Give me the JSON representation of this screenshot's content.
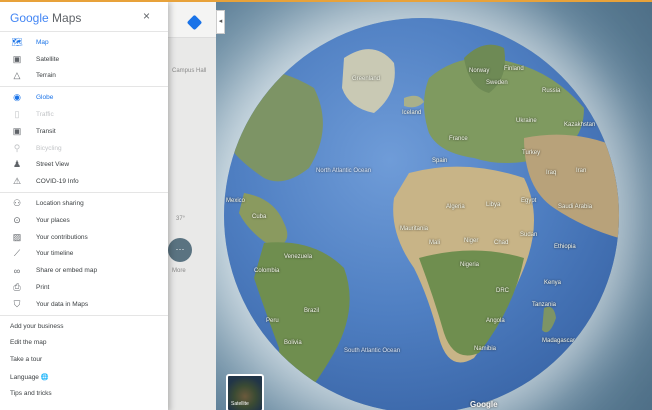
{
  "header": {
    "logo_google": "Google",
    "logo_maps": "Maps",
    "close": "×"
  },
  "menu": {
    "view_group": [
      {
        "icon": "map-icon",
        "glyph": "🗺",
        "label": "Map",
        "state": "active"
      },
      {
        "icon": "satellite-icon",
        "glyph": "▣",
        "label": "Satellite",
        "state": "normal"
      },
      {
        "icon": "terrain-icon",
        "glyph": "△",
        "label": "Terrain",
        "state": "normal"
      }
    ],
    "layers_group": [
      {
        "icon": "globe-icon",
        "glyph": "◉",
        "label": "Globe",
        "state": "active"
      },
      {
        "icon": "traffic-icon",
        "glyph": "▯",
        "label": "Traffic",
        "state": "disabled"
      },
      {
        "icon": "transit-icon",
        "glyph": "▣",
        "label": "Transit",
        "state": "normal"
      },
      {
        "icon": "bicycling-icon",
        "glyph": "⚲",
        "label": "Bicycling",
        "state": "disabled"
      },
      {
        "icon": "street-view-icon",
        "glyph": "♟",
        "label": "Street View",
        "state": "normal"
      },
      {
        "icon": "covid-info-icon",
        "glyph": "⚠",
        "label": "COVID-19 Info",
        "state": "normal"
      }
    ],
    "tools_group": [
      {
        "icon": "location-sharing-icon",
        "glyph": "⚇",
        "label": "Location sharing"
      },
      {
        "icon": "your-places-icon",
        "glyph": "⊙",
        "label": "Your places"
      },
      {
        "icon": "contributions-icon",
        "glyph": "▨",
        "label": "Your contributions"
      },
      {
        "icon": "timeline-icon",
        "glyph": "⟋",
        "label": "Your timeline"
      },
      {
        "icon": "share-embed-icon",
        "glyph": "∞",
        "label": "Share or embed map"
      },
      {
        "icon": "print-icon",
        "glyph": "⎙",
        "label": "Print"
      },
      {
        "icon": "data-in-maps-icon",
        "glyph": "⛉",
        "label": "Your data in Maps"
      }
    ],
    "links": [
      {
        "label": "Add your business"
      },
      {
        "label": "Edit the map"
      },
      {
        "label": "Take a tour"
      },
      {
        "label": "Language 🌐"
      },
      {
        "label": "Tips and tricks"
      }
    ]
  },
  "map": {
    "strip_label": "Campus Hall",
    "strip_temp": "37°",
    "more_label": "More",
    "more_glyph": "···",
    "collapse_glyph": "◂",
    "satellite_thumb_label": "Satellite",
    "google_watermark": "Google",
    "places": {
      "greenland": "Greenland",
      "norway": "Norway",
      "sweden": "Sweden",
      "finland": "Finland",
      "russia": "Russia",
      "ukraine": "Ukraine",
      "kazakhstan": "Kazakhstan",
      "france": "France",
      "spain": "Spain",
      "turkey": "Turkey",
      "iran": "Iran",
      "iraq": "Iraq",
      "algeria": "Algeria",
      "libya": "Libya",
      "egypt": "Egypt",
      "saudi": "Saudi Arabia",
      "mali": "Mali",
      "niger": "Niger",
      "chad": "Chad",
      "sudan": "Sudan",
      "ethiopia": "Ethiopia",
      "nigeria": "Nigeria",
      "mauritania": "Mauritania",
      "drc": "DRC",
      "kenya": "Kenya",
      "tanzania": "Tanzania",
      "angola": "Angola",
      "namibia": "Namibia",
      "madagascar": "Madagascar",
      "brazil": "Brazil",
      "peru": "Peru",
      "bolivia": "Bolivia",
      "venezuela": "Venezuela",
      "colombia": "Colombia",
      "north_atlantic": "North Atlantic Ocean",
      "south_atlantic": "South Atlantic Ocean",
      "cuba": "Cuba",
      "mexico": "Mexico",
      "iceland": "Iceland"
    }
  }
}
